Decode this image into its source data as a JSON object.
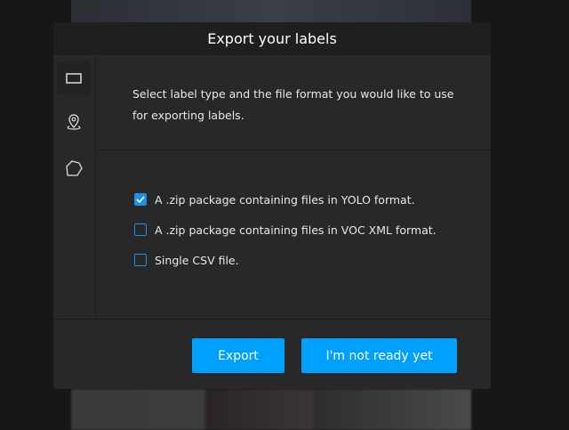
{
  "dialog": {
    "title": "Export your labels",
    "description": "Select label type and the file format you would like to use for exporting labels.",
    "sidebar": [
      {
        "icon": "rectangle-icon",
        "active": true
      },
      {
        "icon": "point-icon",
        "active": false
      },
      {
        "icon": "polygon-icon",
        "active": false
      }
    ],
    "options": [
      {
        "label": "A .zip package containing files in YOLO format.",
        "checked": true
      },
      {
        "label": "A .zip package containing files in VOC XML format.",
        "checked": false
      },
      {
        "label": "Single CSV file.",
        "checked": false
      }
    ],
    "buttons": {
      "export": "Export",
      "not_ready": "I'm not ready yet"
    }
  },
  "colors": {
    "accent": "#00a0ff",
    "checkbox": "#1e90e8"
  }
}
